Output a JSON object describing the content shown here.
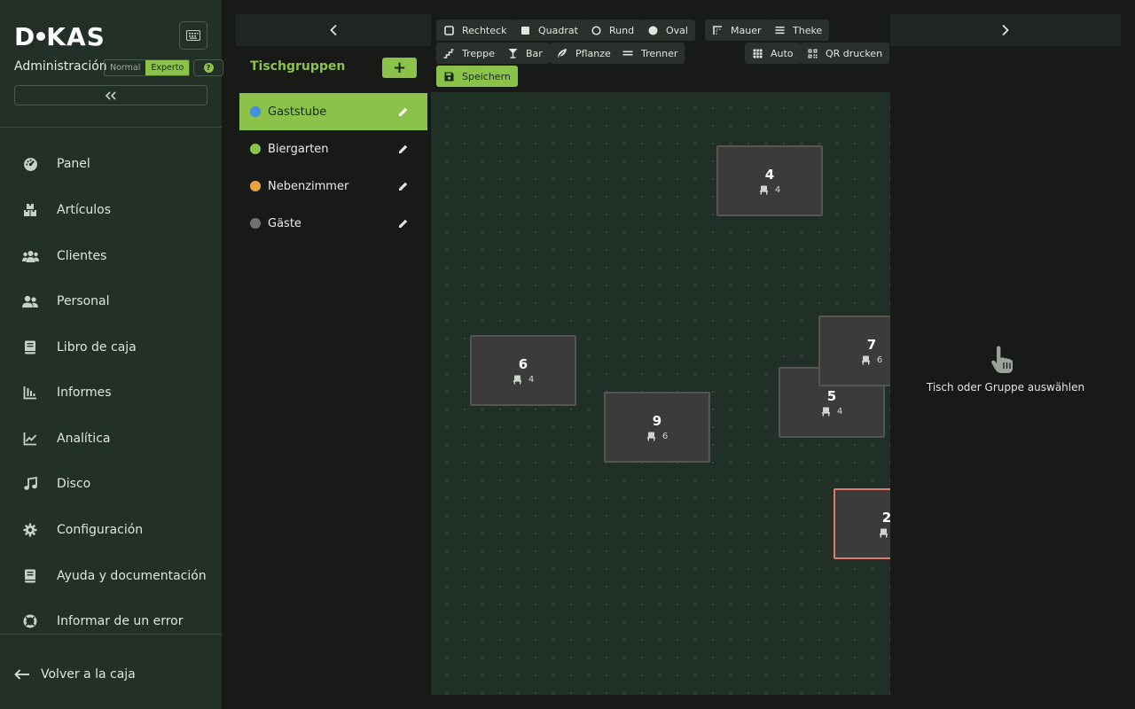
{
  "brand": {
    "logo_text_1": "D",
    "logo_text_2": "KAS"
  },
  "sidebar": {
    "admin_label": "Administración",
    "modes": [
      "Normal",
      "Experto"
    ],
    "help_label": "?",
    "items": [
      {
        "label": "Panel",
        "icon": "dashboard-icon"
      },
      {
        "label": "Artículos",
        "icon": "boxes-icon"
      },
      {
        "label": "Clientes",
        "icon": "users-icon"
      },
      {
        "label": "Personal",
        "icon": "staff-icon"
      },
      {
        "label": "Libro de caja",
        "icon": "book-icon"
      },
      {
        "label": "Informes",
        "icon": "bar-chart-icon"
      },
      {
        "label": "Analítica",
        "icon": "line-chart-icon"
      },
      {
        "label": "Disco",
        "icon": "music-icon"
      },
      {
        "label": "Configuración",
        "icon": "gear-icon"
      },
      {
        "label": "Ayuda y documentación",
        "icon": "help-book-icon"
      },
      {
        "label": "Informar de un error",
        "icon": "lifebuoy-icon"
      }
    ],
    "back_label": "Volver a la caja"
  },
  "groups": {
    "title": "Tischgruppen",
    "add_label": "+",
    "items": [
      {
        "label": "Gaststube",
        "color": "#3f8ee0",
        "active": true
      },
      {
        "label": "Biergarten",
        "color": "#8bc34a",
        "active": false
      },
      {
        "label": "Nebenzimmer",
        "color": "#e8a33c",
        "active": false
      },
      {
        "label": "Gäste",
        "color": "#707070",
        "active": false
      }
    ]
  },
  "toolbar": {
    "rechteck": "Rechteck",
    "quadrat": "Quadrat",
    "rund": "Rund",
    "oval": "Oval",
    "mauer": "Mauer",
    "theke": "Theke",
    "treppe": "Treppe",
    "bar": "Bar",
    "pflanze": "Pflanze",
    "trenner": "Trenner",
    "auto": "Auto",
    "qr": "QR drucken",
    "save": "Speichern"
  },
  "tables": [
    {
      "number": "4",
      "seats": "4",
      "selected": false
    },
    {
      "number": "6",
      "seats": "4",
      "selected": false
    },
    {
      "number": "9",
      "seats": "6",
      "selected": false
    },
    {
      "number": "5",
      "seats": "4",
      "selected": false
    },
    {
      "number": "7",
      "seats": "6",
      "selected": false
    },
    {
      "number": "2",
      "seats": "",
      "selected": true
    }
  ],
  "right_panel": {
    "empty_message": "Tisch oder Gruppe auswählen"
  },
  "colors": {
    "accent": "#8bc34a",
    "sidebar": "#223028",
    "canvas": "#213027",
    "selected_border": "#e07a6a"
  }
}
